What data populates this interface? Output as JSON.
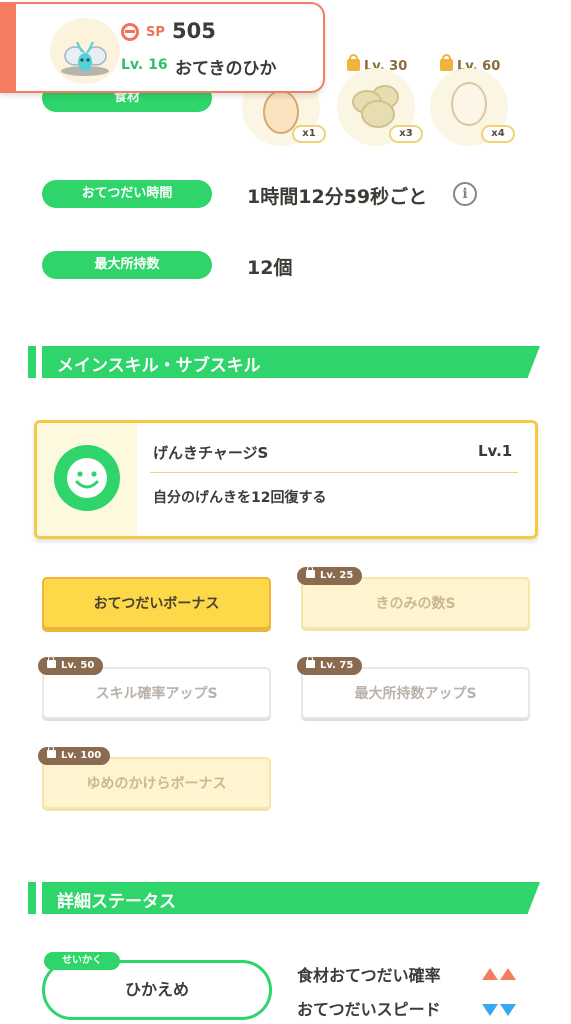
{
  "header": {
    "sp_label": "SP",
    "sp_value": "505",
    "level": "Lv. 16",
    "name": "おてきのひか"
  },
  "ingredients": {
    "label": "食材",
    "items": [
      {
        "unlock": "",
        "qty": "x1",
        "kind": "egg"
      },
      {
        "unlock": "Lv. 30",
        "qty": "x3",
        "kind": "potato"
      },
      {
        "unlock": "Lv. 60",
        "qty": "x4",
        "kind": "egg"
      }
    ]
  },
  "help_time": {
    "label": "おてつだい時間",
    "value": "1時間12分59秒ごと",
    "info": "i"
  },
  "max_carry": {
    "label": "最大所持数",
    "value": "12個"
  },
  "skills_section": {
    "title": "メインスキル・サブスキル"
  },
  "main_skill": {
    "name": "げんきチャージS",
    "level": "Lv.1",
    "description": "自分のげんきを12回復する"
  },
  "sub_skills": [
    {
      "label": "おてつだいボーナス",
      "unlock": ""
    },
    {
      "label": "きのみの数S",
      "unlock": "Lv. 25"
    },
    {
      "label": "スキル確率アップS",
      "unlock": "Lv. 50"
    },
    {
      "label": "最大所持数アップS",
      "unlock": "Lv. 75"
    },
    {
      "label": "ゆめのかけらボーナス",
      "unlock": "Lv. 100"
    }
  ],
  "details_section": {
    "title": "詳細ステータス"
  },
  "nature": {
    "tag": "せいかく",
    "value": "ひかえめ"
  },
  "nature_effects": [
    {
      "label": "食材おてつだい確率",
      "direction": "up"
    },
    {
      "label": "おてつだいスピード",
      "direction": "down"
    }
  ],
  "colors": {
    "accent_green": "#2fd46b",
    "header_orange": "#f47d60",
    "gold": "#f6c844",
    "up": "#f47d60",
    "down": "#36a9f0"
  }
}
